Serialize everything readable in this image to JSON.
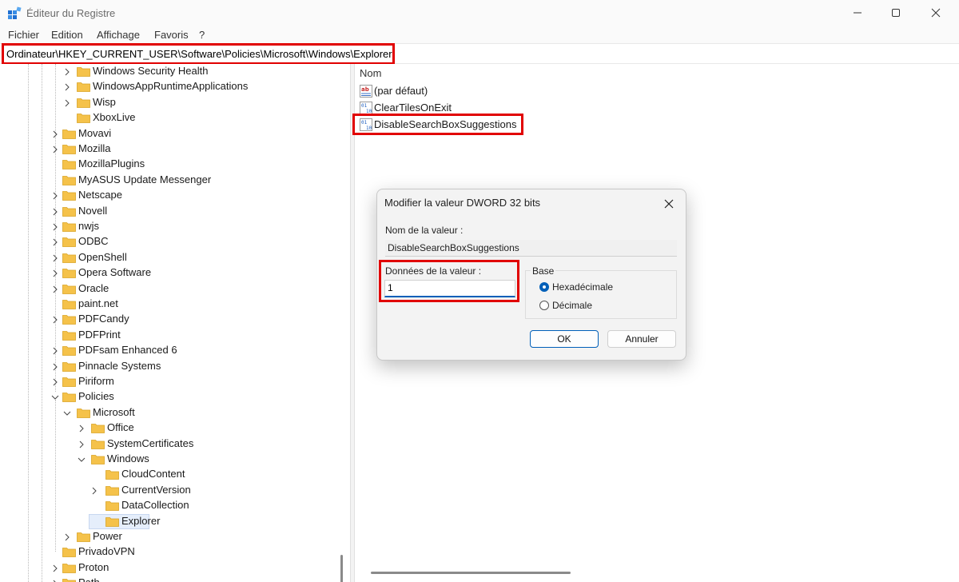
{
  "window": {
    "title": "Éditeur du Registre"
  },
  "menu": {
    "items": [
      "Fichier",
      "Edition",
      "Affichage",
      "Favoris",
      "?"
    ]
  },
  "address": {
    "path": "Ordinateur\\HKEY_CURRENT_USER\\Software\\Policies\\Microsoft\\Windows\\Explorer"
  },
  "tree": {
    "items": [
      {
        "label": "Windows Security Health",
        "expander": "collapsed"
      },
      {
        "label": "WindowsAppRuntimeApplications",
        "expander": "collapsed"
      },
      {
        "label": "Wisp",
        "expander": "collapsed"
      },
      {
        "label": "XboxLive",
        "expander": "none"
      },
      {
        "label": "Movavi",
        "expander": "collapsed"
      },
      {
        "label": "Mozilla",
        "expander": "collapsed"
      },
      {
        "label": "MozillaPlugins",
        "expander": "none"
      },
      {
        "label": "MyASUS Update Messenger",
        "expander": "none"
      },
      {
        "label": "Netscape",
        "expander": "collapsed"
      },
      {
        "label": "Novell",
        "expander": "collapsed"
      },
      {
        "label": "nwjs",
        "expander": "collapsed"
      },
      {
        "label": "ODBC",
        "expander": "collapsed"
      },
      {
        "label": "OpenShell",
        "expander": "collapsed"
      },
      {
        "label": "Opera Software",
        "expander": "collapsed"
      },
      {
        "label": "Oracle",
        "expander": "collapsed"
      },
      {
        "label": "paint.net",
        "expander": "none"
      },
      {
        "label": "PDFCandy",
        "expander": "collapsed"
      },
      {
        "label": "PDFPrint",
        "expander": "none"
      },
      {
        "label": "PDFsam Enhanced 6",
        "expander": "collapsed"
      },
      {
        "label": "Pinnacle Systems",
        "expander": "collapsed"
      },
      {
        "label": "Piriform",
        "expander": "collapsed"
      },
      {
        "label": "Policies",
        "expander": "expanded"
      },
      {
        "label": "Microsoft",
        "expander": "expanded"
      },
      {
        "label": "Office",
        "expander": "collapsed"
      },
      {
        "label": "SystemCertificates",
        "expander": "collapsed"
      },
      {
        "label": "Windows",
        "expander": "expanded"
      },
      {
        "label": "CloudContent",
        "expander": "none"
      },
      {
        "label": "CurrentVersion",
        "expander": "collapsed"
      },
      {
        "label": "DataCollection",
        "expander": "none"
      },
      {
        "label": "Explorer",
        "expander": "none",
        "selected": true
      },
      {
        "label": "Power",
        "expander": "collapsed"
      },
      {
        "label": "PrivadoVPN",
        "expander": "none"
      },
      {
        "label": "Proton",
        "expander": "collapsed"
      },
      {
        "label": "Path",
        "expander": "collapsed"
      }
    ]
  },
  "values": {
    "column_name": "Nom",
    "rows": [
      {
        "name": "(par défaut)",
        "type_icon": "string-value-icon"
      },
      {
        "name": "ClearTilesOnExit",
        "type_icon": "dword-value-icon"
      },
      {
        "name": "DisableSearchBoxSuggestions",
        "type_icon": "dword-value-icon"
      }
    ]
  },
  "dialog": {
    "title": "Modifier la valeur DWORD 32 bits",
    "value_name_label": "Nom de la valeur :",
    "value_name": "DisableSearchBoxSuggestions",
    "value_data_label": "Données de la valeur :",
    "value_data": "1",
    "base_label": "Base",
    "radio_hex": "Hexadécimale",
    "radio_dec": "Décimale",
    "selected_base": "hex",
    "ok": "OK",
    "cancel": "Annuler"
  },
  "colors": {
    "highlight": "#e10000",
    "accent": "#005fb8",
    "folder": "#f5c24a"
  }
}
